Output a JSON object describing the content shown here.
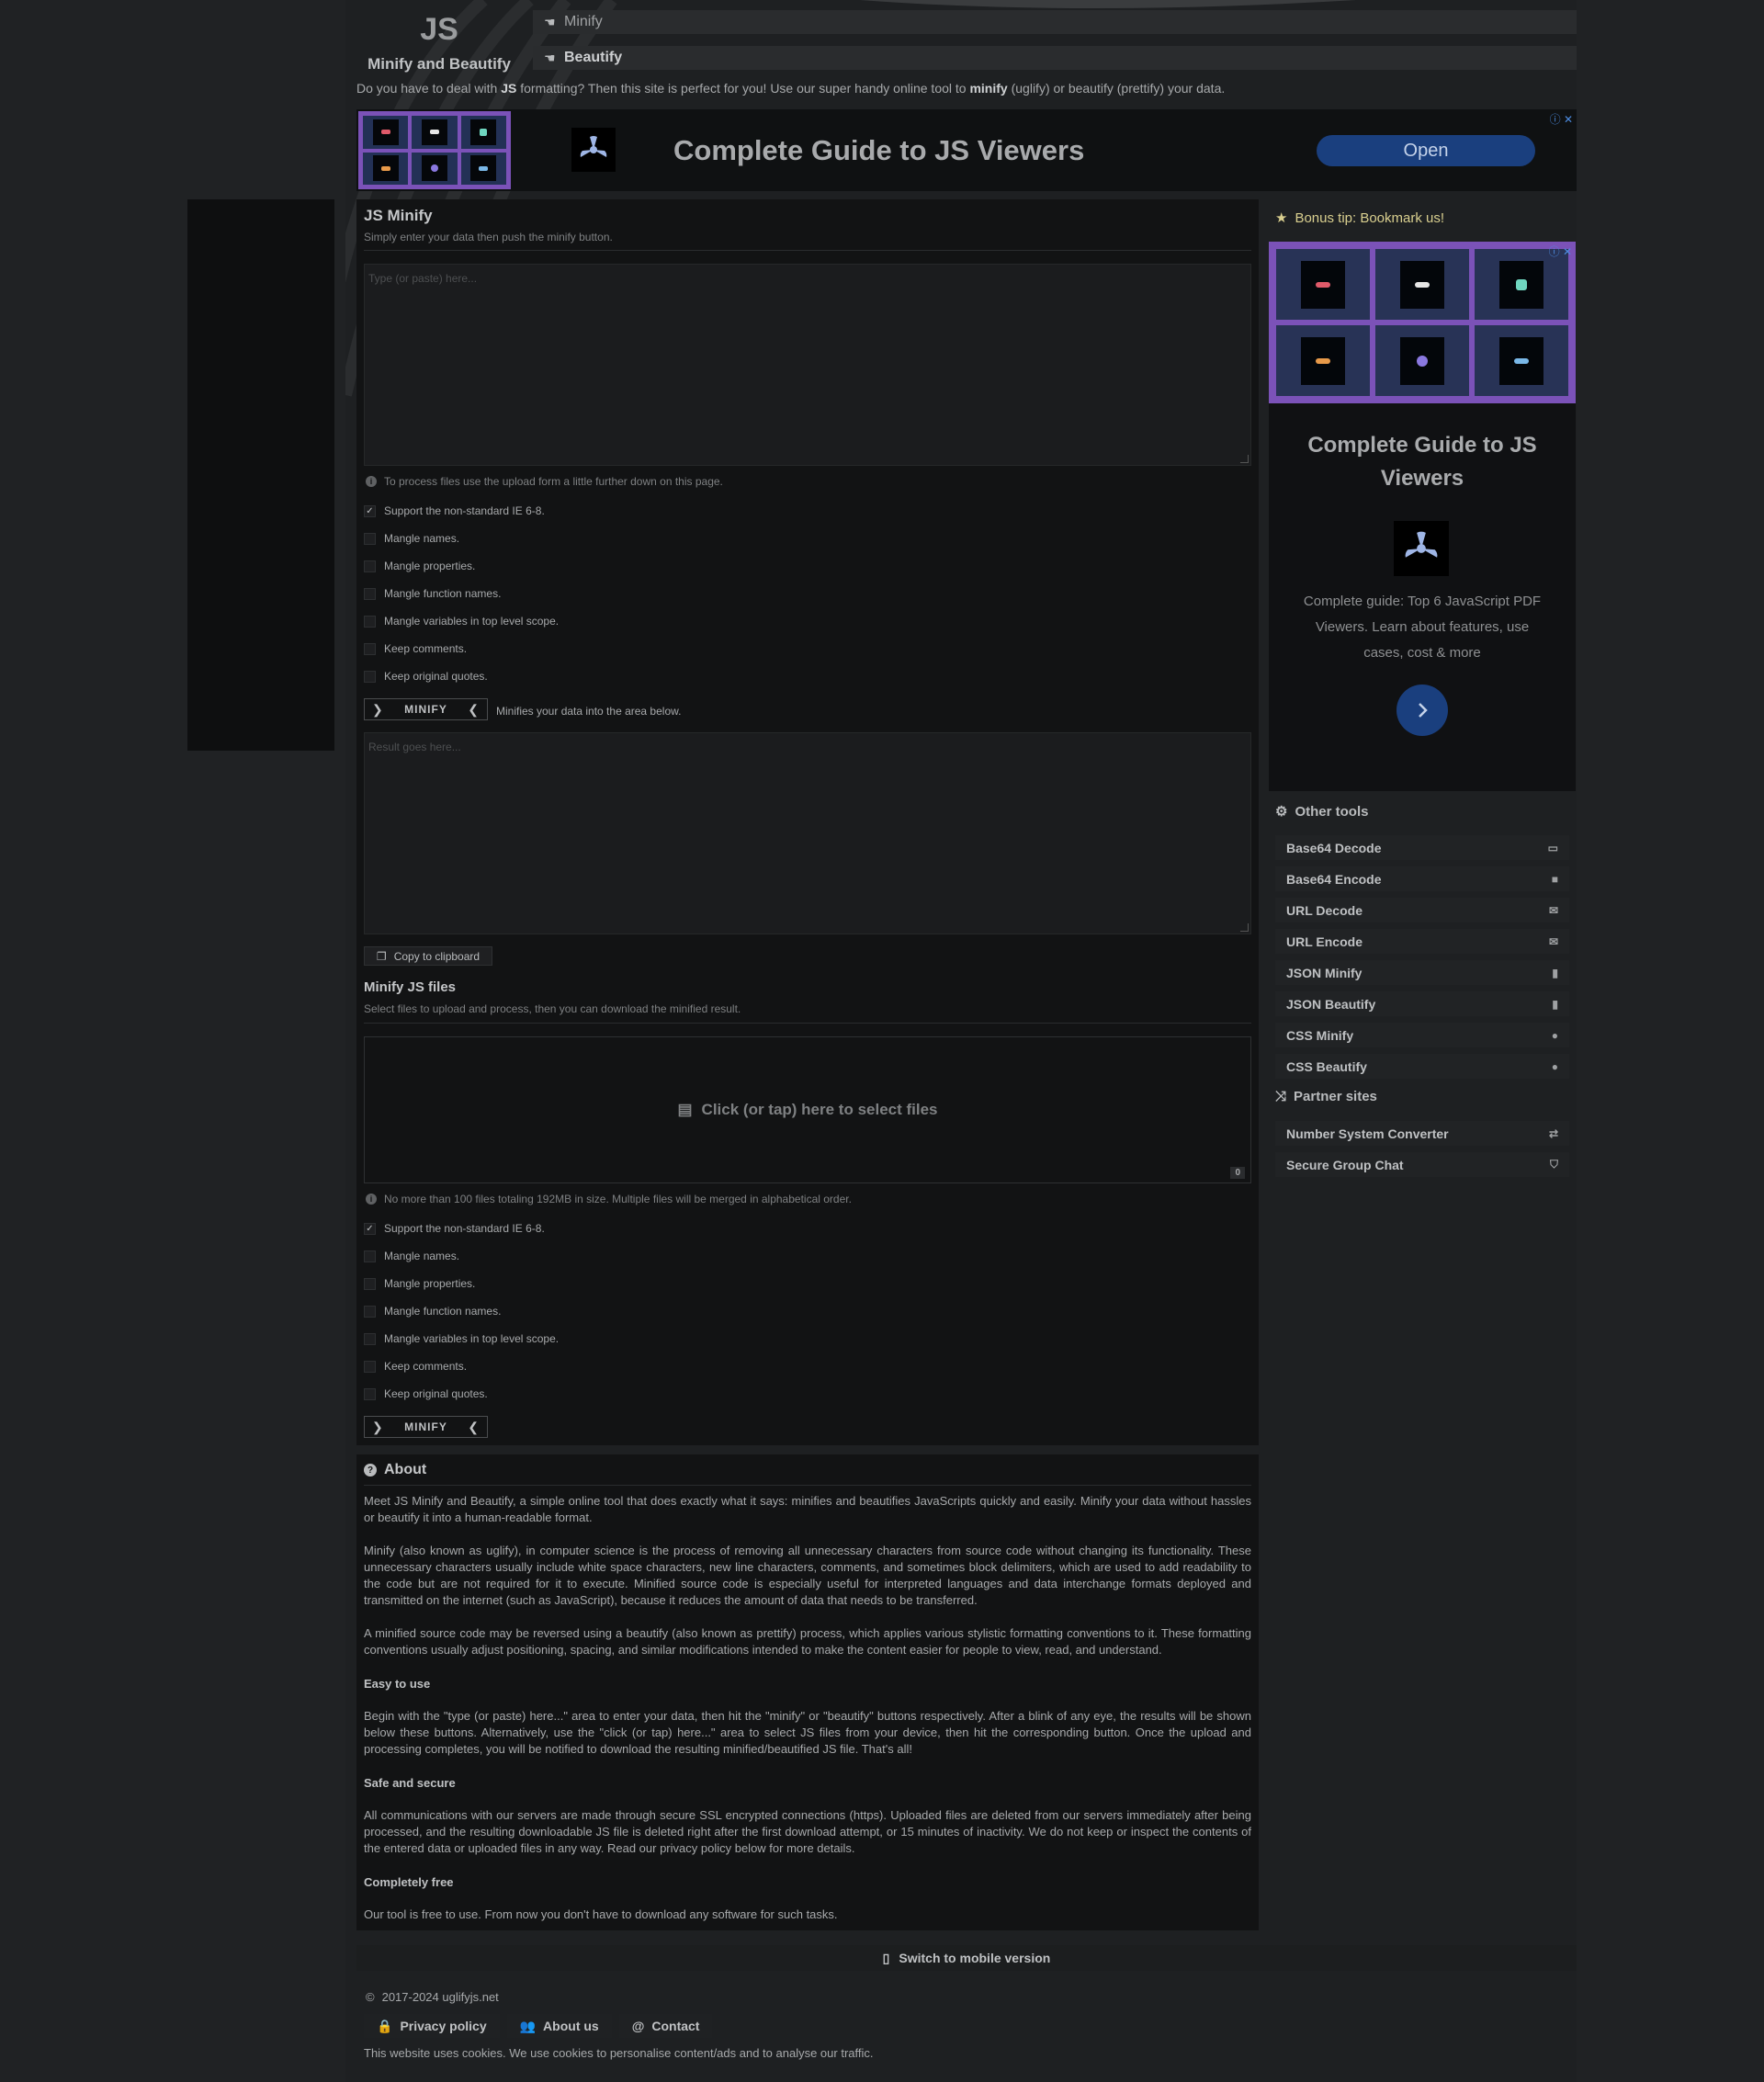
{
  "header": {
    "logo_js": "JS",
    "logo_sub": "Minify and Beautify",
    "nav": [
      {
        "label": "Minify",
        "icon": "hand-icon"
      },
      {
        "label": "Beautify",
        "icon": "hand-icon"
      }
    ],
    "intro_parts": [
      "Do you have to deal with ",
      "JS",
      " formatting? Then this site is perfect for you! Use our super handy online tool to ",
      "minify",
      " (uglify) or beautify (prettify) your data."
    ]
  },
  "banner_ad": {
    "title": "Complete Guide to JS Viewers",
    "open_label": "Open",
    "choice": "ⓘ ✕"
  },
  "minify_panel": {
    "title": "JS Minify",
    "subtitle": "Simply enter your data then push the minify button.",
    "input_placeholder": "Type (or paste) here...",
    "upload_hint": "To process files use the upload form a little further down on this page.",
    "options": [
      {
        "label": "Support the non-standard IE 6-8.",
        "checked": true
      },
      {
        "label": "Mangle names.",
        "checked": false
      },
      {
        "label": "Mangle properties.",
        "checked": false
      },
      {
        "label": "Mangle function names.",
        "checked": false
      },
      {
        "label": "Mangle variables in top level scope.",
        "checked": false
      },
      {
        "label": "Keep comments.",
        "checked": false
      },
      {
        "label": "Keep original quotes.",
        "checked": false
      }
    ],
    "minify_label": "MINIFY",
    "minify_note": "Minifies your data into the area below.",
    "result_placeholder": "Result goes here...",
    "copy_label": "Copy to clipboard"
  },
  "files_panel": {
    "title": "Minify JS files",
    "subtitle": "Select files to upload and process, then you can download the minified result.",
    "drop_label": "Click (or tap) here to select files",
    "file_count": "0",
    "limit_hint": "No more than 100 files totaling 192MB in size. Multiple files will be merged in alphabetical order.",
    "options": [
      {
        "label": "Support the non-standard IE 6-8.",
        "checked": true
      },
      {
        "label": "Mangle names.",
        "checked": false
      },
      {
        "label": "Mangle properties.",
        "checked": false
      },
      {
        "label": "Mangle function names.",
        "checked": false
      },
      {
        "label": "Mangle variables in top level scope.",
        "checked": false
      },
      {
        "label": "Keep comments.",
        "checked": false
      },
      {
        "label": "Keep original quotes.",
        "checked": false
      }
    ],
    "minify_label": "MINIFY"
  },
  "about": {
    "title": "About",
    "p1": "Meet JS Minify and Beautify, a simple online tool that does exactly what it says: minifies and beautifies JavaScripts quickly and easily. Minify your data without hassles or beautify it into a human-readable format.",
    "p2": "Minify (also known as uglify), in computer science is the process of removing all unnecessary characters from source code without changing its functionality. These unnecessary characters usually include white space characters, new line characters, comments, and sometimes block delimiters, which are used to add readability to the code but are not required for it to execute. Minified source code is especially useful for interpreted languages and data interchange formats deployed and transmitted on the internet (such as JavaScript), because it reduces the amount of data that needs to be transferred.",
    "p3": "A minified source code may be reversed using a beautify (also known as prettify) process, which applies various stylistic formatting conventions to it. These formatting conventions usually adjust positioning, spacing, and similar modifications intended to make the content easier for people to view, read, and understand.",
    "h_easy": "Easy to use",
    "p_easy": "Begin with the \"type (or paste) here...\" area to enter your data, then hit the \"minify\" or \"beautify\" buttons respectively. After a blink of any eye, the results will be shown below these buttons. Alternatively, use the \"click (or tap) here...\" area to select JS files from your device, then hit the corresponding button. Once the upload and processing completes, you will be notified to download the resulting minified/beautified JS file. That's all!",
    "h_safe": "Safe and secure",
    "p_safe": "All communications with our servers are made through secure SSL encrypted connections (https). Uploaded files are deleted from our servers immediately after being processed, and the resulting downloadable JS file is deleted right after the first download attempt, or 15 minutes of inactivity. We do not keep or inspect the contents of the entered data or uploaded files in any way. Read our privacy policy below for more details.",
    "h_free": "Completely free",
    "p_free": "Our tool is free to use. From now you don't have to download any software for such tasks."
  },
  "sidebar": {
    "bonus": "Bonus tip: Bookmark us!",
    "ad": {
      "title": "Complete Guide to JS Viewers",
      "desc": "Complete guide: Top 6 JavaScript PDF Viewers. Learn about features, use cases, cost & more",
      "choice": "ⓘ ✕"
    },
    "other_tools_title": "Other tools",
    "tools": [
      {
        "label": "Base64 Decode",
        "icon": "folder-open-icon",
        "glyph": "▭"
      },
      {
        "label": "Base64 Encode",
        "icon": "folder-icon",
        "glyph": "■"
      },
      {
        "label": "URL Decode",
        "icon": "envelope-open-icon",
        "glyph": "✉"
      },
      {
        "label": "URL Encode",
        "icon": "envelope-icon",
        "glyph": "✉"
      },
      {
        "label": "JSON Minify",
        "icon": "file-icon",
        "glyph": "▮"
      },
      {
        "label": "JSON Beautify",
        "icon": "file-text-icon",
        "glyph": "▮"
      },
      {
        "label": "CSS Minify",
        "icon": "smile-icon",
        "glyph": "●"
      },
      {
        "label": "CSS Beautify",
        "icon": "smile-icon",
        "glyph": "●"
      }
    ],
    "partner_title": "Partner sites",
    "partners": [
      {
        "label": "Number System Converter",
        "icon": "exchange-icon",
        "glyph": "⇄"
      },
      {
        "label": "Secure Group Chat",
        "icon": "shield-icon",
        "glyph": "⛉"
      }
    ]
  },
  "footer": {
    "mobile_switch": "Switch to mobile version",
    "copyright": "2017-2024 uglifyjs.net",
    "links": [
      {
        "label": "Privacy policy",
        "icon": "lock-icon",
        "glyph": "🔒"
      },
      {
        "label": "About us",
        "icon": "users-icon",
        "glyph": "👥"
      },
      {
        "label": "Contact",
        "icon": "at-icon",
        "glyph": "@"
      }
    ],
    "cookies": "This website uses cookies. We use cookies to personalise content/ads and to analyse our traffic."
  },
  "colors": {
    "background": "#202224",
    "panel": "#121314",
    "ad_purple": "#7b52b8",
    "ad_blue": "#1a3f7e",
    "bonus_yellow": "#d9cf8f"
  }
}
